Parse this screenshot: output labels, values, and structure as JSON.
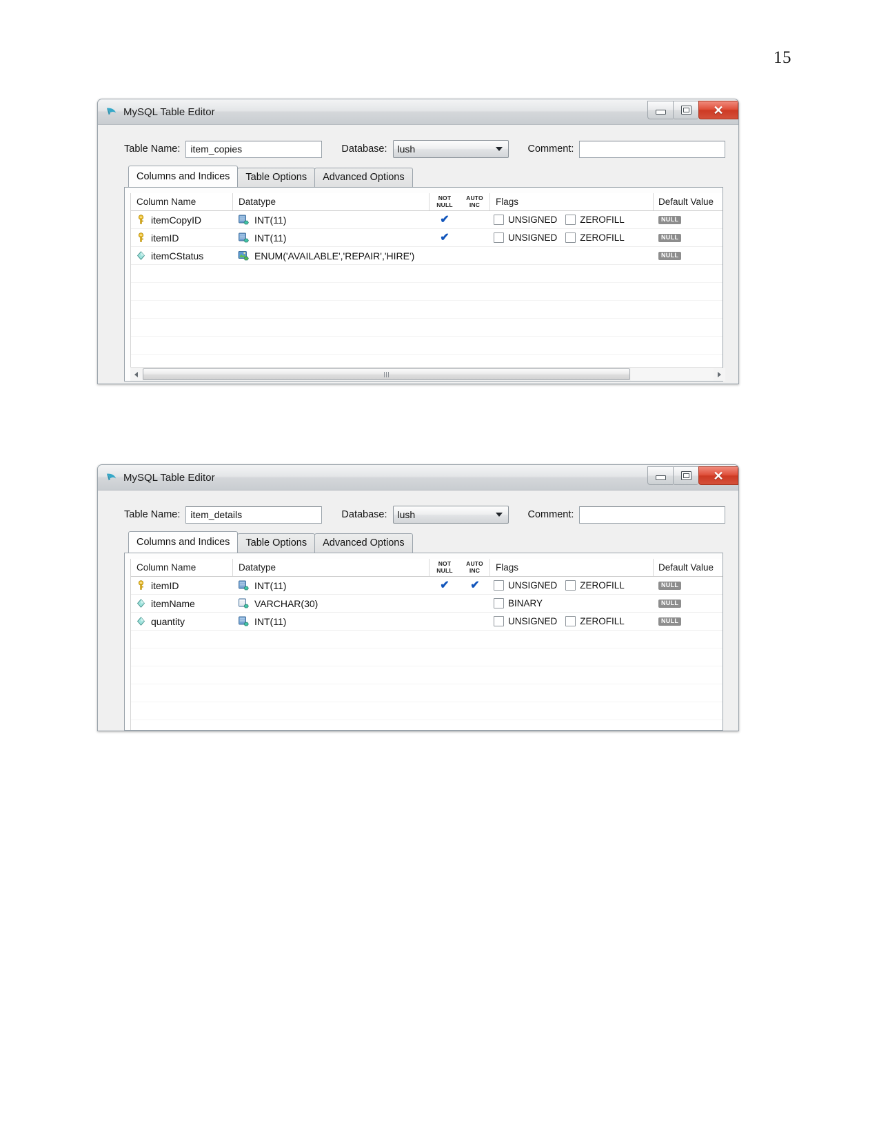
{
  "page": {
    "number": "15"
  },
  "windows": [
    {
      "title": "MySQL Table Editor",
      "title_icon": "mysql-dolphin-icon",
      "controls": {
        "minimize": "minimize-button",
        "maximize": "maximize-button",
        "close_label": "✕"
      },
      "form": {
        "table_name_label": "Table Name:",
        "table_name_value": "item_copies",
        "database_label": "Database:",
        "database_value": "lush",
        "comment_label": "Comment:",
        "comment_value": ""
      },
      "tabs": [
        {
          "label": "Columns and Indices",
          "active": true
        },
        {
          "label": "Table Options",
          "active": false
        },
        {
          "label": "Advanced Options",
          "active": false
        }
      ],
      "grid": {
        "headers": {
          "column_name": "Column Name",
          "datatype": "Datatype",
          "not_null_l1": "NOT",
          "not_null_l2": "NULL",
          "auto_inc_l1": "AUTO",
          "auto_inc_l2": "INC",
          "flags": "Flags",
          "default_value": "Default Value"
        },
        "rows": [
          {
            "icon": "primary-key-icon",
            "name": "itemCopyID",
            "type_icon": "int-datatype-icon",
            "datatype": "INT(11)",
            "not_null": true,
            "auto_inc": false,
            "flags": [
              {
                "label": "UNSIGNED",
                "checked": false
              },
              {
                "label": "ZEROFILL",
                "checked": false
              }
            ],
            "default_value": "NULL"
          },
          {
            "icon": "primary-key-icon",
            "name": "itemID",
            "type_icon": "int-datatype-icon",
            "datatype": "INT(11)",
            "not_null": true,
            "auto_inc": false,
            "flags": [
              {
                "label": "UNSIGNED",
                "checked": false
              },
              {
                "label": "ZEROFILL",
                "checked": false
              }
            ],
            "default_value": "NULL"
          },
          {
            "icon": "column-diamond-icon",
            "name": "itemCStatus",
            "type_icon": "enum-datatype-icon",
            "datatype": "ENUM('AVAILABLE','REPAIR','HIRE')",
            "not_null": false,
            "auto_inc": false,
            "flags": [],
            "default_value": "NULL"
          }
        ],
        "blank_rows": 6
      },
      "scrollbar": {
        "left_arrow": "scroll-left-arrow",
        "right_arrow": "scroll-right-arrow",
        "visible": true
      }
    },
    {
      "title": "MySQL Table Editor",
      "title_icon": "mysql-dolphin-icon",
      "controls": {
        "minimize": "minimize-button",
        "maximize": "maximize-button",
        "close_label": "✕"
      },
      "form": {
        "table_name_label": "Table Name:",
        "table_name_value": "item_details",
        "database_label": "Database:",
        "database_value": "lush",
        "comment_label": "Comment:",
        "comment_value": ""
      },
      "tabs": [
        {
          "label": "Columns and Indices",
          "active": true
        },
        {
          "label": "Table Options",
          "active": false
        },
        {
          "label": "Advanced Options",
          "active": false
        }
      ],
      "grid": {
        "headers": {
          "column_name": "Column Name",
          "datatype": "Datatype",
          "not_null_l1": "NOT",
          "not_null_l2": "NULL",
          "auto_inc_l1": "AUTO",
          "auto_inc_l2": "INC",
          "flags": "Flags",
          "default_value": "Default Value"
        },
        "rows": [
          {
            "icon": "primary-key-icon",
            "name": "itemID",
            "type_icon": "int-datatype-icon",
            "datatype": "INT(11)",
            "not_null": true,
            "auto_inc": true,
            "flags": [
              {
                "label": "UNSIGNED",
                "checked": false
              },
              {
                "label": "ZEROFILL",
                "checked": false
              }
            ],
            "default_value": "NULL"
          },
          {
            "icon": "column-diamond-icon",
            "name": "itemName",
            "type_icon": "varchar-datatype-icon",
            "datatype": "VARCHAR(30)",
            "not_null": false,
            "auto_inc": false,
            "flags": [
              {
                "label": "BINARY",
                "checked": false
              }
            ],
            "default_value": "NULL"
          },
          {
            "icon": "column-diamond-icon",
            "name": "quantity",
            "type_icon": "int-datatype-icon",
            "datatype": "INT(11)",
            "not_null": false,
            "auto_inc": false,
            "flags": [
              {
                "label": "UNSIGNED",
                "checked": false
              },
              {
                "label": "ZEROFILL",
                "checked": false
              }
            ],
            "default_value": "NULL"
          }
        ],
        "blank_rows": 5
      },
      "scrollbar": {
        "left_arrow": "scroll-left-arrow",
        "right_arrow": "scroll-right-arrow",
        "visible": false
      }
    }
  ]
}
